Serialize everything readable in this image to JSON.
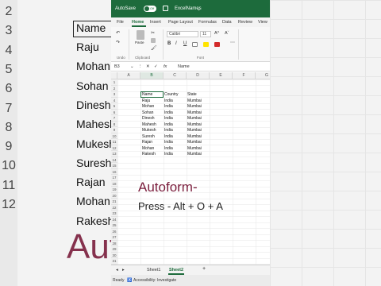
{
  "background": {
    "row_numbers": [
      "2",
      "3",
      "4",
      "5",
      "6",
      "7",
      "8",
      "9",
      "10",
      "11",
      "12"
    ],
    "header": "Name",
    "names": [
      "Raju",
      "Mohan",
      "Sohan",
      "Dinesh",
      "Mahesh",
      "Mukesh",
      "Suresh",
      "Rajan",
      "Mohan",
      "Rakesh"
    ],
    "big_text": "Auto"
  },
  "titlebar": {
    "autosave_label": "AutoSave",
    "toggle_state": "Off",
    "file_name": "ExcelNames"
  },
  "tabs": [
    "File",
    "Home",
    "Insert",
    "Page Layout",
    "Formulas",
    "Data",
    "Review",
    "View"
  ],
  "active_tab": "Home",
  "ribbon": {
    "paste_label": "Paste",
    "font_name": "Calibri",
    "font_size": "11",
    "groups": [
      "Undo",
      "Clipboard",
      "Font"
    ],
    "bold": "B",
    "italic": "I",
    "underline": "U",
    "grow_font": "A^",
    "shrink_font": "Aˇ"
  },
  "formula_bar": {
    "name_box": "B3",
    "fx": "fx",
    "content": "Name"
  },
  "columns": [
    "A",
    "B",
    "C",
    "D",
    "E",
    "F",
    "G"
  ],
  "rows": [
    "1",
    "2",
    "3",
    "4",
    "5",
    "6",
    "7",
    "8",
    "9",
    "10",
    "11",
    "12",
    "13",
    "14",
    "15",
    "16",
    "17",
    "18",
    "19",
    "20",
    "21",
    "22",
    "23",
    "24",
    "25",
    "26",
    "27",
    "28",
    "29",
    "30",
    "31"
  ],
  "table": {
    "headers": [
      "Name",
      "Country",
      "State"
    ],
    "rows": [
      [
        "Raju",
        "India",
        "Mumbai"
      ],
      [
        "Mohan",
        "India",
        "Mumbai"
      ],
      [
        "Sohan",
        "India",
        "Mumbai"
      ],
      [
        "Dinesh",
        "India",
        "Mumbai"
      ],
      [
        "Mahesh",
        "India",
        "Mumbai"
      ],
      [
        "Mukesh",
        "India",
        "Mumbai"
      ],
      [
        "Suresh",
        "India",
        "Mumbai"
      ],
      [
        "Rajan",
        "India",
        "Mumbai"
      ],
      [
        "Mohan",
        "India",
        "Mumbai"
      ],
      [
        "Rakesh",
        "India",
        "Mumbai"
      ]
    ]
  },
  "overlay": {
    "title": "Autoform-",
    "shortcut": "Press -  Alt + O + A"
  },
  "sheets": [
    "Sheet1",
    "Sheet2"
  ],
  "active_sheet": "Sheet2",
  "add_sheet": "+",
  "status": {
    "ready": "Ready",
    "accessibility": "Accessibility: Investigate"
  },
  "colors": {
    "excel_green": "#1d6b3c",
    "overlay_title": "#7a1d3c"
  }
}
